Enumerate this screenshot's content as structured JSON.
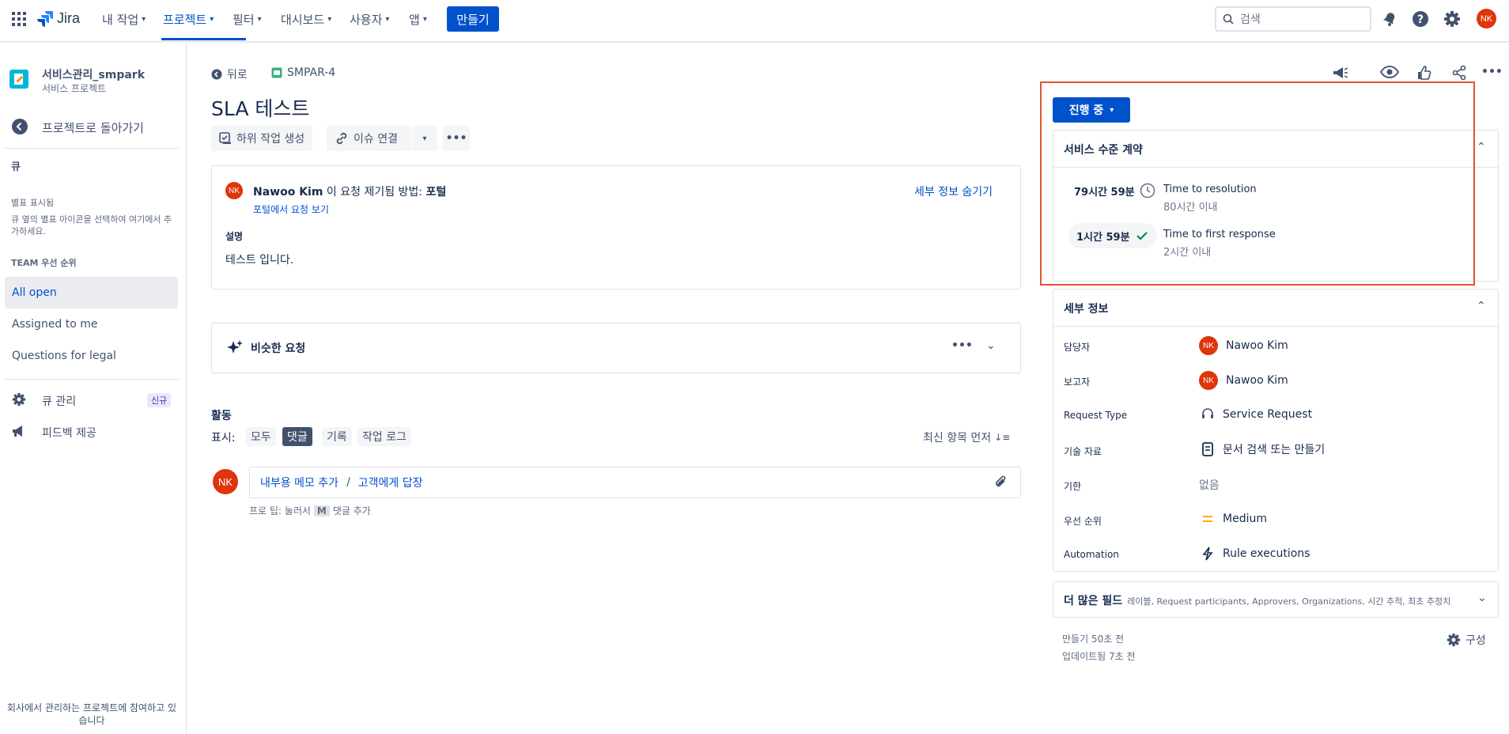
{
  "nav": {
    "product": "Jira",
    "items": [
      "내 작업",
      "프로젝트",
      "필터",
      "대시보드",
      "사용자",
      "앱"
    ],
    "create": "만들기",
    "search_placeholder": "검색",
    "user_initials": "NK"
  },
  "sidebar": {
    "project_name": "서비스관리_smpark",
    "project_type": "서비스 프로젝트",
    "back_to_projects": "프로젝트로 돌아가기",
    "queue_header": "큐",
    "star_title": "별표 표시됨",
    "star_hint": "큐 옆의 별표 아이콘을 선택하여 여기에서 추가하세요.",
    "team_priority": "TEAM 우선 순위",
    "queues": [
      "All open",
      "Assigned to me",
      "Questions for legal"
    ],
    "queue_manage": "큐 관리",
    "new_badge": "신규",
    "feedback": "피드백 제공",
    "footer": "회사에서 관리하는 프로젝트에 참여하고 있습니다"
  },
  "issue": {
    "back": "뒤로",
    "key": "SMPAR-4",
    "title": "SLA 테스트",
    "create_subtask": "하위 작업 생성",
    "link_issue": "이슈 연결",
    "reporter_initials": "NK",
    "reporter": "Nawoo Kim",
    "raised_text": "이 요청 제기됨 방법:",
    "raised_channel": "포털",
    "view_portal": "포털에서 요청 보기",
    "hide_details": "세부 정보 숨기기",
    "description_label": "설명",
    "description": "테스트 입니다.",
    "similar_requests": "비슷한 요청",
    "activity": "활동",
    "show_label": "표시:",
    "filters": [
      "모두",
      "댓글",
      "기록",
      "작업 로그"
    ],
    "selected_filter": "댓글",
    "sort": "최신 항목 먼저",
    "internal_note": "내부용 메모 추가",
    "separator": "/",
    "reply_customer": "고객에게 답장",
    "tip_prefix": "프로 팁: 눌러서",
    "tip_key": "M",
    "tip_suffix": "댓글 추가"
  },
  "right": {
    "status": "진행 중",
    "sla_title": "서비스 수준 계약",
    "sla": [
      {
        "remaining": "79시간 59분",
        "name": "Time to resolution",
        "target": "80시간 이내",
        "state": "clock"
      },
      {
        "remaining": "1시간 59분",
        "name": "Time to first response",
        "target": "2시간 이내",
        "state": "check"
      }
    ],
    "details_title": "세부 정보",
    "fields": {
      "assignee_label": "담당자",
      "assignee": "Nawoo Kim",
      "assignee_initials": "NK",
      "reporter_label": "보고자",
      "reporter": "Nawoo Kim",
      "reporter_initials": "NK",
      "request_type_label": "Request Type",
      "request_type": "Service Request",
      "knowledge_label": "기술 자료",
      "knowledge": "문서 검색 또는 만들기",
      "due_label": "기한",
      "due": "없음",
      "priority_label": "우선 순위",
      "priority": "Medium",
      "automation_label": "Automation",
      "automation": "Rule executions"
    },
    "more_fields_title": "더 많은 필드",
    "more_fields_list": "레이블, Request participants, Approvers, Organizations, 시간 추적, 최초 추정치",
    "created": "만들기 50초 전",
    "updated": "업데이트됨 7초 전",
    "configure": "구성"
  },
  "colors": {
    "accent": "#0052cc",
    "avatar": "#de350b",
    "highlight": "#e5532f",
    "check": "#00875a",
    "priority": "#ffab00"
  }
}
